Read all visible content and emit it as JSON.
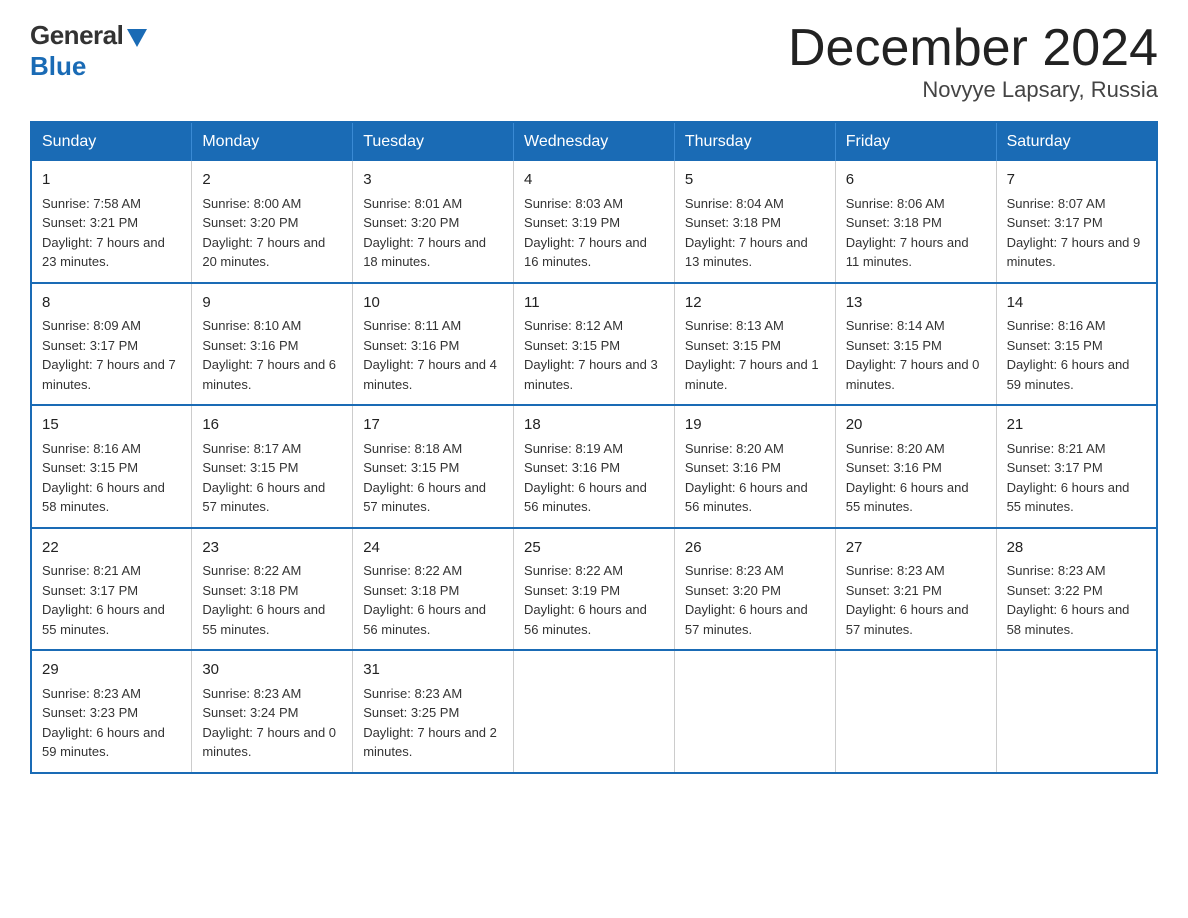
{
  "logo": {
    "general": "General",
    "blue": "Blue"
  },
  "title": "December 2024",
  "subtitle": "Novyye Lapsary, Russia",
  "weekdays": [
    "Sunday",
    "Monday",
    "Tuesday",
    "Wednesday",
    "Thursday",
    "Friday",
    "Saturday"
  ],
  "weeks": [
    [
      {
        "day": "1",
        "sunrise": "7:58 AM",
        "sunset": "3:21 PM",
        "daylight": "7 hours and 23 minutes."
      },
      {
        "day": "2",
        "sunrise": "8:00 AM",
        "sunset": "3:20 PM",
        "daylight": "7 hours and 20 minutes."
      },
      {
        "day": "3",
        "sunrise": "8:01 AM",
        "sunset": "3:20 PM",
        "daylight": "7 hours and 18 minutes."
      },
      {
        "day": "4",
        "sunrise": "8:03 AM",
        "sunset": "3:19 PM",
        "daylight": "7 hours and 16 minutes."
      },
      {
        "day": "5",
        "sunrise": "8:04 AM",
        "sunset": "3:18 PM",
        "daylight": "7 hours and 13 minutes."
      },
      {
        "day": "6",
        "sunrise": "8:06 AM",
        "sunset": "3:18 PM",
        "daylight": "7 hours and 11 minutes."
      },
      {
        "day": "7",
        "sunrise": "8:07 AM",
        "sunset": "3:17 PM",
        "daylight": "7 hours and 9 minutes."
      }
    ],
    [
      {
        "day": "8",
        "sunrise": "8:09 AM",
        "sunset": "3:17 PM",
        "daylight": "7 hours and 7 minutes."
      },
      {
        "day": "9",
        "sunrise": "8:10 AM",
        "sunset": "3:16 PM",
        "daylight": "7 hours and 6 minutes."
      },
      {
        "day": "10",
        "sunrise": "8:11 AM",
        "sunset": "3:16 PM",
        "daylight": "7 hours and 4 minutes."
      },
      {
        "day": "11",
        "sunrise": "8:12 AM",
        "sunset": "3:15 PM",
        "daylight": "7 hours and 3 minutes."
      },
      {
        "day": "12",
        "sunrise": "8:13 AM",
        "sunset": "3:15 PM",
        "daylight": "7 hours and 1 minute."
      },
      {
        "day": "13",
        "sunrise": "8:14 AM",
        "sunset": "3:15 PM",
        "daylight": "7 hours and 0 minutes."
      },
      {
        "day": "14",
        "sunrise": "8:16 AM",
        "sunset": "3:15 PM",
        "daylight": "6 hours and 59 minutes."
      }
    ],
    [
      {
        "day": "15",
        "sunrise": "8:16 AM",
        "sunset": "3:15 PM",
        "daylight": "6 hours and 58 minutes."
      },
      {
        "day": "16",
        "sunrise": "8:17 AM",
        "sunset": "3:15 PM",
        "daylight": "6 hours and 57 minutes."
      },
      {
        "day": "17",
        "sunrise": "8:18 AM",
        "sunset": "3:15 PM",
        "daylight": "6 hours and 57 minutes."
      },
      {
        "day": "18",
        "sunrise": "8:19 AM",
        "sunset": "3:16 PM",
        "daylight": "6 hours and 56 minutes."
      },
      {
        "day": "19",
        "sunrise": "8:20 AM",
        "sunset": "3:16 PM",
        "daylight": "6 hours and 56 minutes."
      },
      {
        "day": "20",
        "sunrise": "8:20 AM",
        "sunset": "3:16 PM",
        "daylight": "6 hours and 55 minutes."
      },
      {
        "day": "21",
        "sunrise": "8:21 AM",
        "sunset": "3:17 PM",
        "daylight": "6 hours and 55 minutes."
      }
    ],
    [
      {
        "day": "22",
        "sunrise": "8:21 AM",
        "sunset": "3:17 PM",
        "daylight": "6 hours and 55 minutes."
      },
      {
        "day": "23",
        "sunrise": "8:22 AM",
        "sunset": "3:18 PM",
        "daylight": "6 hours and 55 minutes."
      },
      {
        "day": "24",
        "sunrise": "8:22 AM",
        "sunset": "3:18 PM",
        "daylight": "6 hours and 56 minutes."
      },
      {
        "day": "25",
        "sunrise": "8:22 AM",
        "sunset": "3:19 PM",
        "daylight": "6 hours and 56 minutes."
      },
      {
        "day": "26",
        "sunrise": "8:23 AM",
        "sunset": "3:20 PM",
        "daylight": "6 hours and 57 minutes."
      },
      {
        "day": "27",
        "sunrise": "8:23 AM",
        "sunset": "3:21 PM",
        "daylight": "6 hours and 57 minutes."
      },
      {
        "day": "28",
        "sunrise": "8:23 AM",
        "sunset": "3:22 PM",
        "daylight": "6 hours and 58 minutes."
      }
    ],
    [
      {
        "day": "29",
        "sunrise": "8:23 AM",
        "sunset": "3:23 PM",
        "daylight": "6 hours and 59 minutes."
      },
      {
        "day": "30",
        "sunrise": "8:23 AM",
        "sunset": "3:24 PM",
        "daylight": "7 hours and 0 minutes."
      },
      {
        "day": "31",
        "sunrise": "8:23 AM",
        "sunset": "3:25 PM",
        "daylight": "7 hours and 2 minutes."
      },
      null,
      null,
      null,
      null
    ]
  ]
}
